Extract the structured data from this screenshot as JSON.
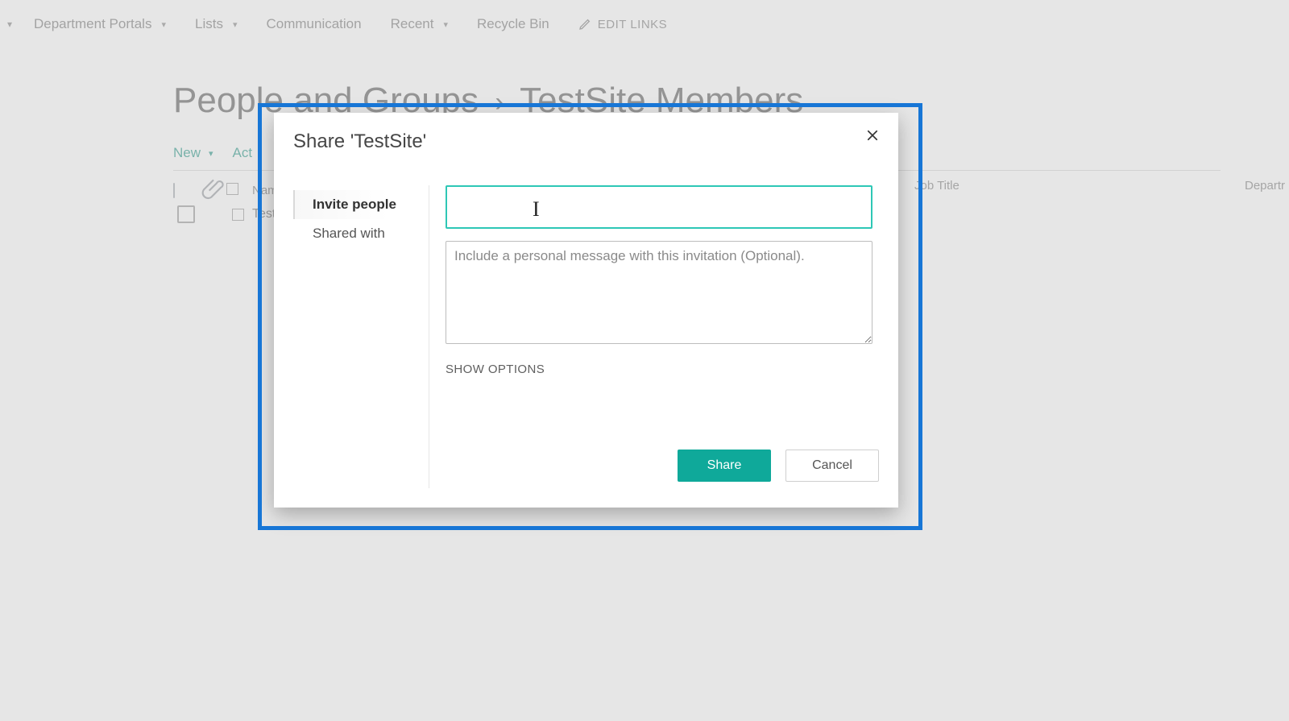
{
  "topnav": {
    "items": [
      {
        "label": "Department Portals",
        "dropdown": true
      },
      {
        "label": "Lists",
        "dropdown": true
      },
      {
        "label": "Communication",
        "dropdown": false
      },
      {
        "label": "Recent",
        "dropdown": true
      },
      {
        "label": "Recycle Bin",
        "dropdown": false
      }
    ],
    "edit_links_label": "EDIT LINKS"
  },
  "page": {
    "title_left": "People and Groups",
    "title_right": "TestSite Members"
  },
  "actionbar": {
    "new_label": "New",
    "actions_label": "Act"
  },
  "columns": {
    "name": "Name",
    "job_title": "Job Title",
    "department": "Departr"
  },
  "rows": [
    {
      "name_fragment": "Test"
    }
  ],
  "dialog": {
    "title": "Share 'TestSite'",
    "tabs": {
      "invite": "Invite people",
      "shared_with": "Shared with"
    },
    "people_input_value": "",
    "message_placeholder": "Include a personal message with this invitation (Optional).",
    "show_options": "SHOW OPTIONS",
    "share_button": "Share",
    "cancel_button": "Cancel"
  },
  "colors": {
    "accent_teal": "#0fa99a",
    "input_focus": "#2ec7b6",
    "highlight_blue": "#1776d6"
  }
}
